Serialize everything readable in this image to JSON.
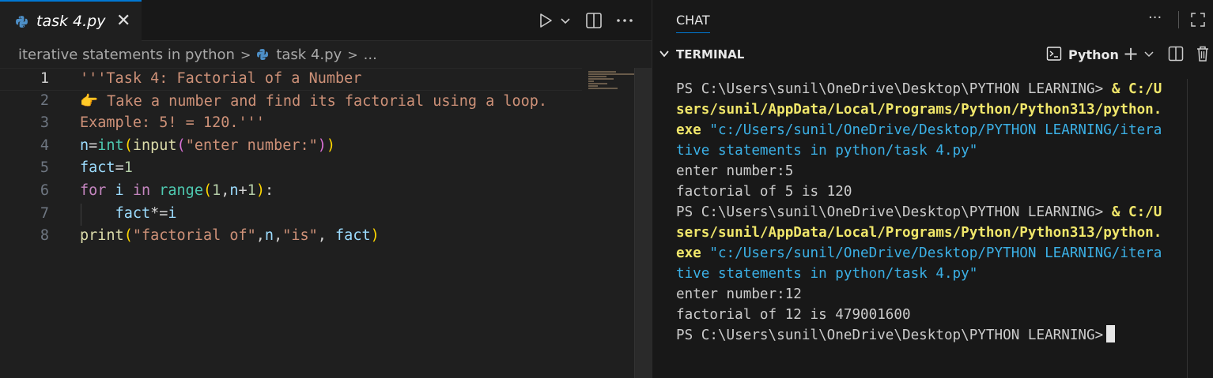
{
  "editor": {
    "tab_label": "task 4.py",
    "tab_close": "✕",
    "breadcrumb": {
      "folder": "iterative statements in python",
      "file": "task 4.py",
      "tail": "..."
    },
    "lines": [
      {
        "n": "1",
        "tokens": [
          {
            "t": "'''Task 4: Factorial of a Number",
            "c": "s-str"
          }
        ]
      },
      {
        "n": "2",
        "tokens": [
          {
            "t": "👉 Take a number and find its factorial using a loop.",
            "c": "s-str"
          }
        ]
      },
      {
        "n": "3",
        "tokens": [
          {
            "t": "Example: 5! = 120.'''",
            "c": "s-str"
          }
        ]
      },
      {
        "n": "4",
        "tokens": [
          {
            "t": "n",
            "c": "s-var"
          },
          {
            "t": "=",
            "c": "s-op"
          },
          {
            "t": "int",
            "c": "s-fn"
          },
          {
            "t": "(",
            "c": "s-br1"
          },
          {
            "t": "input",
            "c": "s-fnc"
          },
          {
            "t": "(",
            "c": "s-br2"
          },
          {
            "t": "\"enter number:\"",
            "c": "s-str"
          },
          {
            "t": ")",
            "c": "s-br2"
          },
          {
            "t": ")",
            "c": "s-br1"
          }
        ]
      },
      {
        "n": "5",
        "tokens": [
          {
            "t": "fact",
            "c": "s-var"
          },
          {
            "t": "=",
            "c": "s-op"
          },
          {
            "t": "1",
            "c": "s-num"
          }
        ]
      },
      {
        "n": "6",
        "tokens": [
          {
            "t": "for",
            "c": "s-kw"
          },
          {
            "t": " i ",
            "c": "s-var"
          },
          {
            "t": "in",
            "c": "s-kw"
          },
          {
            "t": " ",
            "c": "s-op"
          },
          {
            "t": "range",
            "c": "s-fn"
          },
          {
            "t": "(",
            "c": "s-br1"
          },
          {
            "t": "1",
            "c": "s-num"
          },
          {
            "t": ",",
            "c": "s-op"
          },
          {
            "t": "n",
            "c": "s-var"
          },
          {
            "t": "+",
            "c": "s-op"
          },
          {
            "t": "1",
            "c": "s-num"
          },
          {
            "t": ")",
            "c": "s-br1"
          },
          {
            "t": ":",
            "c": "s-op"
          }
        ]
      },
      {
        "n": "7",
        "tokens": [
          {
            "t": "    ",
            "c": "s-op"
          },
          {
            "t": "fact",
            "c": "s-var"
          },
          {
            "t": "*=",
            "c": "s-op"
          },
          {
            "t": "i",
            "c": "s-var"
          }
        ]
      },
      {
        "n": "8",
        "tokens": [
          {
            "t": "print",
            "c": "s-fnc"
          },
          {
            "t": "(",
            "c": "s-br1"
          },
          {
            "t": "\"factorial of\"",
            "c": "s-str"
          },
          {
            "t": ",",
            "c": "s-op"
          },
          {
            "t": "n",
            "c": "s-var"
          },
          {
            "t": ",",
            "c": "s-op"
          },
          {
            "t": "\"is\"",
            "c": "s-str"
          },
          {
            "t": ", ",
            "c": "s-op"
          },
          {
            "t": "fact",
            "c": "s-var"
          },
          {
            "t": ")",
            "c": "s-br1"
          }
        ]
      }
    ]
  },
  "panel": {
    "chat_tab": "CHAT",
    "more": "···",
    "terminal_title": "TERMINAL",
    "shell_label": "Python",
    "add_label": "+"
  },
  "terminal": {
    "lines": [
      [
        {
          "t": "PS C:\\Users\\sunil\\OneDrive\\Desktop\\PYTHON LEARNING> ",
          "c": ""
        },
        {
          "t": "& C:/U",
          "c": "t-yellow"
        }
      ],
      [
        {
          "t": "sers/sunil/AppData/Local/Programs/Python/Python313/python.",
          "c": "t-yellow"
        }
      ],
      [
        {
          "t": "exe",
          "c": "t-yellow"
        },
        {
          "t": " \"c:/Users/sunil/OneDrive/Desktop/PYTHON LEARNING/itera",
          "c": "t-blue"
        }
      ],
      [
        {
          "t": "tive statements in python/task 4.py\"",
          "c": "t-blue"
        }
      ],
      [
        {
          "t": "enter number:5",
          "c": ""
        }
      ],
      [
        {
          "t": "factorial of 5 is 120",
          "c": ""
        }
      ],
      [
        {
          "t": "PS C:\\Users\\sunil\\OneDrive\\Desktop\\PYTHON LEARNING> ",
          "c": ""
        },
        {
          "t": "& C:/U",
          "c": "t-yellow"
        }
      ],
      [
        {
          "t": "sers/sunil/AppData/Local/Programs/Python/Python313/python.",
          "c": "t-yellow"
        }
      ],
      [
        {
          "t": "exe",
          "c": "t-yellow"
        },
        {
          "t": " \"c:/Users/sunil/OneDrive/Desktop/PYTHON LEARNING/itera",
          "c": "t-blue"
        }
      ],
      [
        {
          "t": "tive statements in python/task 4.py\"",
          "c": "t-blue"
        }
      ],
      [
        {
          "t": "enter number:12",
          "c": ""
        }
      ],
      [
        {
          "t": "factorial of 12 is 479001600",
          "c": ""
        }
      ],
      [
        {
          "t": "PS C:\\Users\\sunil\\OneDrive\\Desktop\\PYTHON LEARNING>",
          "c": ""
        }
      ]
    ]
  },
  "colors": {
    "accent": "#0078d4",
    "editor_bg": "#1f1f1f",
    "panel_bg": "#181818"
  }
}
